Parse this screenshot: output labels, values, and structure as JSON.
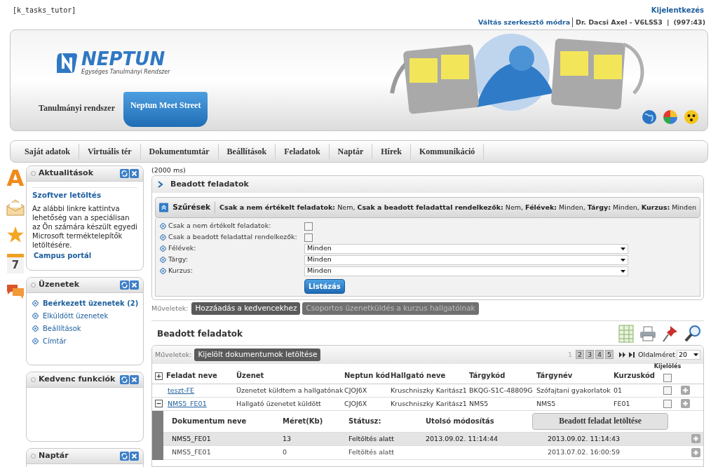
{
  "page_code": "[k_tasks_tutor]",
  "user_bar": {
    "logout": "Kijelentkezés",
    "edit_mode": "Váltás szerkesztő módra",
    "user": "Dr. Dacsi Axel - V6LSS3",
    "separator": "|",
    "session": "(997:43)"
  },
  "header": {
    "logo": "NEPTUN",
    "subtitle": "Egységes Tanulmányi Rendszer",
    "tabs": [
      {
        "label": "Tanulmányi rendszer",
        "selected": false
      },
      {
        "label": "Neptun Meet Street",
        "selected": true
      }
    ]
  },
  "menu": [
    "Saját adatok",
    "Virtuális tér",
    "Dokumentumtár",
    "Beállítások",
    "Feladatok",
    "Naptár",
    "Hírek",
    "Kommunikáció"
  ],
  "dock": {
    "letter": "A",
    "calendar_day": "7"
  },
  "sidebar": [
    {
      "title": "Aktualitások",
      "kind": "news",
      "heading": "Szoftver letöltés",
      "text": "Az alábbi linkre kattintva lehetőség van a speciálisan az Ön számára készült egyedi Microsoft terméktelepítők letöltésére.",
      "link": "Campus portál"
    },
    {
      "title": "Üzenetek",
      "kind": "links",
      "items": [
        {
          "label": "Beérkezett üzenetek (2)",
          "bold": true
        },
        {
          "label": "Elküldött üzenetek",
          "bold": false
        },
        {
          "label": "Beállítások",
          "bold": false
        },
        {
          "label": "Címtár",
          "bold": false
        }
      ]
    },
    {
      "title": "Kedvenc funkciók",
      "kind": "empty"
    },
    {
      "title": "Naptár",
      "kind": "empty"
    }
  ],
  "timing": "(2000 ms)",
  "main": {
    "title": "Beadott feladatok",
    "filters": {
      "label": "Szűrések",
      "summary": "**Csak a nem értékelt feladatok:** Nem, **Csak a beadott feladattal rendelkezők:** Nem, **Félévek:** Minden, **Tárgy:** Minden, **Kurzus:** Minden",
      "fields": [
        {
          "label": "Csak a nem értékelt feladatok:",
          "kind": "checkbox",
          "checked": false
        },
        {
          "label": "Csak a beadott feladattal rendelkezők:",
          "kind": "checkbox",
          "checked": false
        },
        {
          "label": "Félévek:",
          "kind": "select",
          "value": "Minden"
        },
        {
          "label": "Tárgy:",
          "kind": "select",
          "value": "Minden"
        },
        {
          "label": "Kurzus:",
          "kind": "select",
          "value": "Minden"
        }
      ],
      "button": "Listázás"
    },
    "actions": {
      "label": "Műveletek:",
      "buttons": [
        {
          "label": "Hozzáadás a kedvencekhez",
          "disabled": false
        },
        {
          "label": "Csoportos üzenetküldés a kurzus hallgatóinak",
          "disabled": true
        }
      ]
    },
    "results": {
      "title": "Beadott feladatok",
      "actions_label": "Műveletek:",
      "action": "Kijelölt dokumentumok letöltése",
      "pages": [
        {
          "label": "1",
          "selected": true
        },
        {
          "label": "2",
          "selected": false
        },
        {
          "label": "3",
          "selected": false
        },
        {
          "label": "4",
          "selected": false
        },
        {
          "label": "5",
          "selected": false
        }
      ],
      "page_size_label": "Oldalméret",
      "page_size": "20",
      "columns": [
        "Feladat neve",
        "Üzenet",
        "Neptun kód",
        "Hallgató neve",
        "Tárgykód",
        "Tárgynév",
        "Kurzuskód"
      ],
      "select_column": "Kijelölés",
      "select_all_checked": false,
      "rows": [
        {
          "checked": false,
          "cells": [
            "teszt-FE",
            "Üzenetet küldtem a hallgatónak",
            "CJOJ6X",
            "Kruschniszky Karitász1",
            "BKQG-S1C-48809G",
            "Szófajtani gyakorlatok",
            "01"
          ]
        },
        {
          "expanded": true,
          "checked": false,
          "cells": [
            "NMS5_FE01",
            "Hallgató üzenetet küldött",
            "CJOJ6X",
            "Kruschniszky Karitász1",
            "NMS5",
            "NMS5",
            "FE01"
          ],
          "documents": {
            "columns": [
              "Dokumentum neve",
              "Méret(Kb)",
              "Státusz:",
              "Utolsó módosítás"
            ],
            "button": "Beadott feladat letöltése",
            "rows": [
              {
                "selected": true,
                "cells": [
                  "NMS5_FE01",
                  "13",
                  "Feltöltés alatt",
                  "2013.09.02. 11:14:44",
                  "2013.09.02. 11:14:43"
                ]
              },
              {
                "selected": false,
                "cells": [
                  "NMS5_FE01",
                  "0",
                  "Feltöltés alatt",
                  "",
                  "2013.07.02. 16:00:59"
                ]
              }
            ]
          }
        }
      ]
    }
  }
}
